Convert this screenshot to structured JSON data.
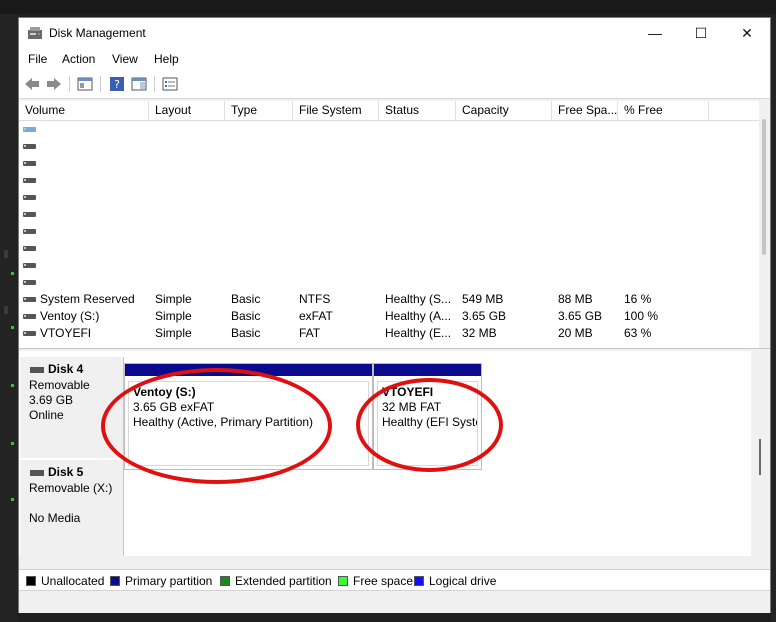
{
  "window": {
    "title": "Disk Management",
    "minimize": "—",
    "maximize": "☐",
    "close": "✕"
  },
  "menu": [
    "File",
    "Action",
    "View",
    "Help"
  ],
  "toolbar": {
    "icons": [
      "back-icon",
      "forward-icon",
      "properties-icon",
      "help-icon",
      "show-hide-icon",
      "settings-list-icon"
    ]
  },
  "columns": [
    "Volume",
    "Layout",
    "Type",
    "File System",
    "Status",
    "Capacity",
    "Free Spa...",
    "% Free"
  ],
  "volumes": [
    {
      "volume": "System Reserved",
      "layout": "Simple",
      "type": "Basic",
      "fs": "NTFS",
      "status": "Healthy (S...",
      "capacity": "549 MB",
      "free": "88 MB",
      "pct": "16 %"
    },
    {
      "volume": "Ventoy (S:)",
      "layout": "Simple",
      "type": "Basic",
      "fs": "exFAT",
      "status": "Healthy (A...",
      "capacity": "3.65 GB",
      "free": "3.65 GB",
      "pct": "100 %"
    },
    {
      "volume": "VTOYEFI",
      "layout": "Simple",
      "type": "Basic",
      "fs": "FAT",
      "status": "Healthy (E...",
      "capacity": "32 MB",
      "free": "20 MB",
      "pct": "63 %"
    }
  ],
  "disks": [
    {
      "name": "Disk 4",
      "kind": "Removable",
      "size": "3.69 GB",
      "state": "Online"
    },
    {
      "name": "Disk 5",
      "kind": "Removable (X:)",
      "state": "No Media"
    }
  ],
  "partitions": [
    {
      "name": "Ventoy  (S:)",
      "size": "3.65 GB exFAT",
      "status": "Healthy (Active, Primary Partition)"
    },
    {
      "name": "VTOYEFI",
      "size": "32 MB FAT",
      "status": "Healthy (EFI System Partition)"
    }
  ],
  "legend": [
    {
      "label": "Unallocated",
      "color": "#000000"
    },
    {
      "label": "Primary partition",
      "color": "#0a0a8c"
    },
    {
      "label": "Extended partition",
      "color": "#1a8a1a"
    },
    {
      "label": "Free space",
      "color": "#33ff33"
    },
    {
      "label": "Logical drive",
      "color": "#1010ff"
    }
  ],
  "annotation_color": "#e01010"
}
